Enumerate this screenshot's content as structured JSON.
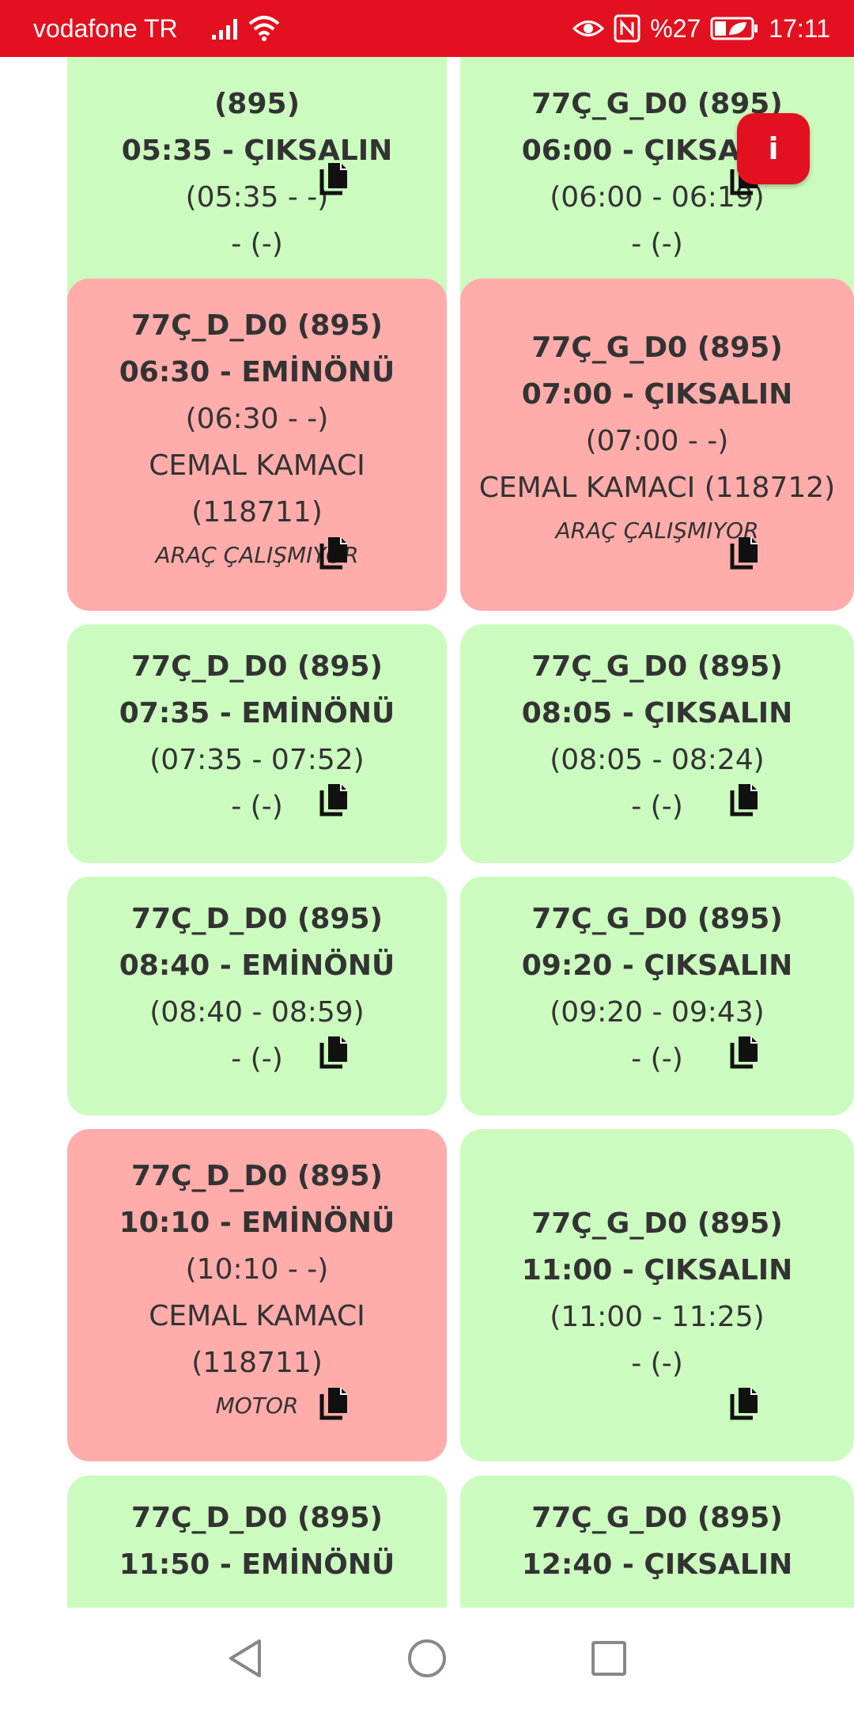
{
  "status_bar": {
    "carrier": "vodafone TR",
    "battery": "%27",
    "time": "17:11",
    "icons": [
      "signal-icon",
      "wifi-icon",
      "eye-icon",
      "nfc-icon",
      "battery-icon"
    ]
  },
  "colors": {
    "ok": "#ccfbbf",
    "fault": "#ffacab",
    "accent": "#e3111f"
  },
  "fab_label": "i",
  "trips": [
    {
      "status": "ok",
      "line": "(895)",
      "time": "05:35 - ÇIKSALIN",
      "range": "(05:35 - -)",
      "driver": "- (-)",
      "driver2": "",
      "note": ""
    },
    {
      "status": "ok",
      "line": "77Ç_G_D0 (895)",
      "time": "06:00 - ÇIKSALIN",
      "range": "(06:00 - 06:19)",
      "driver": "- (-)",
      "driver2": "",
      "note": ""
    },
    {
      "status": "fault",
      "line": "77Ç_D_D0 (895)",
      "time": "06:30 - EMİNÖNÜ",
      "range": "(06:30 - -)",
      "driver": "CEMAL KAMACI",
      "driver2": "(118711)",
      "note": "ARAÇ ÇALIŞMIYOR"
    },
    {
      "status": "fault",
      "line": "77Ç_G_D0 (895)",
      "time": "07:00 - ÇIKSALIN",
      "range": "(07:00 - -)",
      "driver": "CEMAL KAMACI (118712)",
      "driver2": "",
      "note": "ARAÇ ÇALIŞMIYOR"
    },
    {
      "status": "ok",
      "line": "77Ç_D_D0 (895)",
      "time": "07:35 - EMİNÖNÜ",
      "range": "(07:35 - 07:52)",
      "driver": "- (-)",
      "driver2": "",
      "note": ""
    },
    {
      "status": "ok",
      "line": "77Ç_G_D0 (895)",
      "time": "08:05 - ÇIKSALIN",
      "range": "(08:05 - 08:24)",
      "driver": "- (-)",
      "driver2": "",
      "note": ""
    },
    {
      "status": "ok",
      "line": "77Ç_D_D0 (895)",
      "time": "08:40 - EMİNÖNÜ",
      "range": "(08:40 - 08:59)",
      "driver": "- (-)",
      "driver2": "",
      "note": ""
    },
    {
      "status": "ok",
      "line": "77Ç_G_D0 (895)",
      "time": "09:20 - ÇIKSALIN",
      "range": "(09:20 - 09:43)",
      "driver": "- (-)",
      "driver2": "",
      "note": ""
    },
    {
      "status": "fault",
      "line": "77Ç_D_D0 (895)",
      "time": "10:10 - EMİNÖNÜ",
      "range": "(10:10 - -)",
      "driver": "CEMAL KAMACI",
      "driver2": "(118711)",
      "note": "MOTOR"
    },
    {
      "status": "ok",
      "line": "77Ç_G_D0 (895)",
      "time": "11:00 - ÇIKSALIN",
      "range": "(11:00 - 11:25)",
      "driver": "- (-)",
      "driver2": "",
      "note": ""
    },
    {
      "status": "ok",
      "line": "77Ç_D_D0 (895)",
      "time": "11:50 - EMİNÖNÜ",
      "range": "",
      "driver": "",
      "driver2": "",
      "note": ""
    },
    {
      "status": "ok",
      "line": "77Ç_G_D0 (895)",
      "time": "12:40 - ÇIKSALIN",
      "range": "",
      "driver": "",
      "driver2": "",
      "note": ""
    }
  ]
}
